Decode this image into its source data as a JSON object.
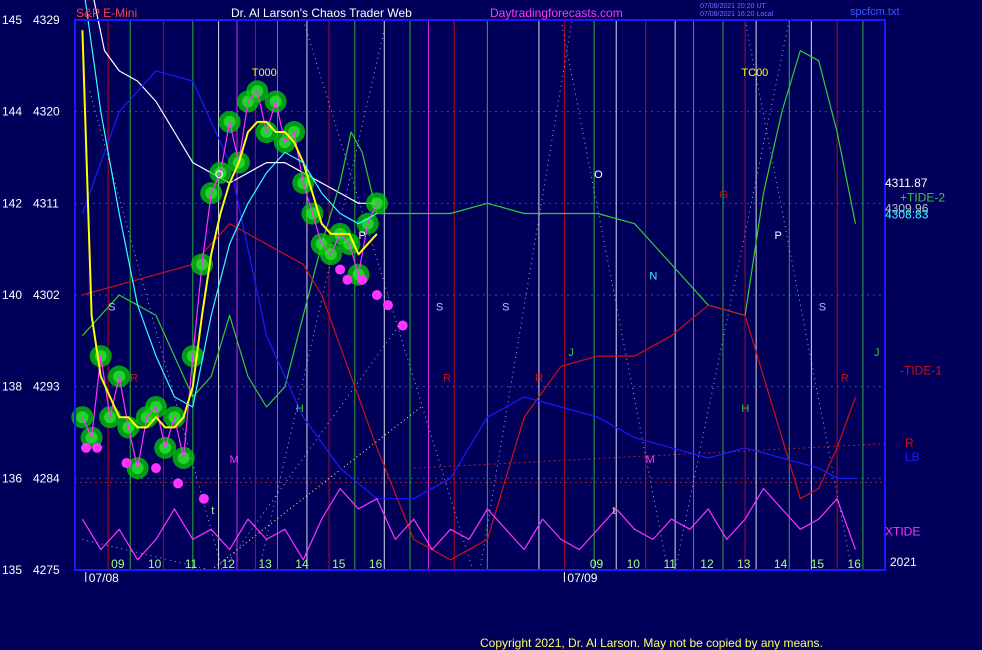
{
  "header": {
    "symbol": "S&P E-Mini",
    "title": "Dr. Al Larson's Chaos Trader Web",
    "site": "Daytradingforecasts.com",
    "file": "spcfcm.txt",
    "timestamp_line1": "07/08/2021 20:20 UT",
    "timestamp_line2": "07/08/2021 16:20 Local"
  },
  "footer": {
    "copyright": "Copyright 2021, Dr. Al Larson. May not be copied by any means."
  },
  "colors": {
    "background": "#00005a",
    "frame": "#1a1aff",
    "price": "#ff33ff",
    "ma_yellow": "#ffff00",
    "ma_cyan": "#33ffff",
    "ma_white": "#ffffff",
    "tide2_green": "#33cc33",
    "tide1_red": "#cc1111",
    "lb_blue": "#1a1aff",
    "xtide_magenta": "#ff33ff",
    "glow_green": "#00dd00",
    "tick_green": "#a0ff80"
  },
  "chart_data": {
    "type": "line",
    "title": "S&P E-Mini",
    "y_axis": {
      "ylim": [
        4275,
        4329
      ],
      "ticks": [
        {
          "index": "135",
          "price": "4275",
          "value": 4275
        },
        {
          "index": "136",
          "price": "4284",
          "value": 4284
        },
        {
          "index": "138",
          "price": "4293",
          "value": 4293
        },
        {
          "index": "140",
          "price": "4302",
          "value": 4302
        },
        {
          "index": "142",
          "price": "4311",
          "value": 4311
        },
        {
          "index": "144",
          "price": "4320",
          "value": 4320
        },
        {
          "index": "145",
          "price": "4329",
          "value": 4329
        }
      ]
    },
    "x_axis": {
      "ticks": [
        {
          "label": "09",
          "x": 9
        },
        {
          "label": "10",
          "x": 10
        },
        {
          "label": "11",
          "x": 11
        },
        {
          "label": "12",
          "x": 12
        },
        {
          "label": "13",
          "x": 13
        },
        {
          "label": "14",
          "x": 14
        },
        {
          "label": "15",
          "x": 15
        },
        {
          "label": "16",
          "x": 16
        },
        {
          "label": "09",
          "x": 22
        },
        {
          "label": "10",
          "x": 23
        },
        {
          "label": "11",
          "x": 24
        },
        {
          "label": "12",
          "x": 25
        },
        {
          "label": "13",
          "x": 26
        },
        {
          "label": "14",
          "x": 27
        },
        {
          "label": "15",
          "x": 28
        },
        {
          "label": "16",
          "x": 29
        }
      ],
      "dates": [
        {
          "label": "07/08",
          "x": 8.5
        },
        {
          "label": "07/09",
          "x": 21.5
        }
      ],
      "year": "2021"
    },
    "series": [
      {
        "name": "",
        "color": "#ff33ff",
        "x": [
          8.0,
          8.25,
          8.5,
          8.75,
          9.0,
          9.25,
          9.5,
          9.75,
          10.0,
          10.25,
          10.5,
          10.75,
          11.0,
          11.25,
          11.5,
          11.75,
          12.0,
          12.25,
          12.5,
          12.75,
          13.0,
          13.25,
          13.5,
          13.75,
          14.0,
          14.25,
          14.5,
          14.75,
          15.0,
          15.25,
          15.5,
          15.75,
          16.0
        ],
        "y": [
          4290,
          4288,
          4296,
          4290,
          4294,
          4289,
          4285,
          4290,
          4291,
          4287,
          4290,
          4286,
          4296,
          4305,
          4312,
          4314,
          4319,
          4315,
          4321,
          4322,
          4318,
          4321,
          4317,
          4318,
          4313,
          4310,
          4307,
          4306,
          4308,
          4307,
          4304,
          4309,
          4311
        ]
      },
      {
        "name": "",
        "color": "#ffff00",
        "x": [
          8.0,
          8.25,
          8.5,
          8.75,
          9.0,
          9.25,
          9.5,
          9.75,
          10.0,
          10.25,
          10.5,
          10.75,
          11.0,
          11.25,
          11.5,
          11.75,
          12.0,
          12.25,
          12.5,
          12.75,
          13.0,
          13.25,
          13.5,
          13.75,
          14.0,
          14.25,
          14.5,
          14.75,
          15.0,
          15.25,
          15.5,
          15.75,
          16.0
        ],
        "y": [
          4328,
          4300,
          4294,
          4292,
          4290,
          4290,
          4289,
          4289,
          4290,
          4289,
          4289,
          4290,
          4293,
          4300,
          4306,
          4310,
          4313,
          4315,
          4318,
          4319,
          4319,
          4318,
          4318,
          4317,
          4315,
          4312,
          4309,
          4308,
          4308,
          4308,
          4306,
          4307,
          4308
        ]
      },
      {
        "name": "",
        "color": "#33ffff",
        "x": [
          8.0,
          8.5,
          9.0,
          9.5,
          10.0,
          10.5,
          11.0,
          11.5,
          12.0,
          12.5,
          13.0,
          13.5,
          14.0,
          14.5,
          15.0,
          15.5,
          16.0
        ],
        "y": [
          4333,
          4320,
          4310,
          4301,
          4296,
          4292,
          4291,
          4300,
          4307,
          4311,
          4314,
          4316,
          4315,
          4312,
          4310,
          4309,
          4310
        ]
      },
      {
        "name": "",
        "color": "#ffffff",
        "x": [
          8.2,
          8.6,
          9.0,
          9.5,
          10.0,
          10.5,
          11.0,
          11.5,
          12.0,
          12.5,
          13.0,
          13.5,
          14.0,
          14.5,
          15.0,
          15.5,
          16.0
        ],
        "y": [
          4333,
          4326,
          4324,
          4323,
          4321,
          4318,
          4315,
          4314,
          4313,
          4314,
          4315,
          4315,
          4314,
          4313,
          4312,
          4311,
          4311
        ]
      },
      {
        "name": "TIDE-2",
        "color": "#33cc33",
        "x": [
          8.0,
          9.0,
          10.0,
          10.5,
          11.0,
          11.5,
          12.0,
          12.5,
          13.0,
          13.5,
          14.0,
          14.5,
          15.0,
          15.3,
          15.6,
          16.0,
          17.0,
          18.0,
          19.0,
          20.0,
          21.0,
          22.0,
          23.0,
          24.0,
          25.0,
          26.0,
          26.5,
          27.0,
          27.5,
          28.0,
          28.5,
          29.0
        ],
        "y": [
          4298,
          4302,
          4300,
          4296,
          4292,
          4294,
          4300,
          4294,
          4291,
          4293,
          4300,
          4307,
          4313,
          4318,
          4316,
          4310,
          4310,
          4310,
          4311,
          4310,
          4310,
          4310,
          4309,
          4305,
          4301,
          4300,
          4312,
          4320,
          4326,
          4325,
          4318,
          4309
        ]
      },
      {
        "name": "TIDE-1",
        "color": "#cc1111",
        "x": [
          8.0,
          9.0,
          10.0,
          11.0,
          12.0,
          13.0,
          14.0,
          14.5,
          15.0,
          15.5,
          16.0,
          17.0,
          18.0,
          19.0,
          20.0,
          21.0,
          22.0,
          23.0,
          24.0,
          25.0,
          26.0,
          27.0,
          27.5,
          28.0,
          28.5,
          29.0
        ],
        "y": [
          4302,
          4303,
          4304,
          4305,
          4309,
          4307,
          4305,
          4302,
          4297,
          4292,
          4287,
          4278,
          4276,
          4278,
          4290,
          4295,
          4296,
          4296,
          4298,
          4301,
          4300,
          4288,
          4282,
          4283,
          4287,
          4292
        ]
      },
      {
        "name": "LB",
        "color": "#1a1aff",
        "x": [
          8.0,
          9.0,
          10.0,
          11.0,
          12.0,
          13.0,
          14.0,
          15.0,
          16.0,
          17.0,
          18.0,
          19.0,
          20.0,
          21.0,
          22.0,
          23.0,
          24.0,
          25.0,
          26.0,
          27.0,
          28.0,
          28.5,
          29.0
        ],
        "y": [
          4310,
          4320,
          4324,
          4323,
          4315,
          4298,
          4290,
          4285,
          4282,
          4282,
          4284,
          4290,
          4292,
          4291,
          4290,
          4288,
          4287,
          4286,
          4287,
          4286,
          4285,
          4284,
          4284
        ]
      },
      {
        "name": "XTIDE",
        "color": "#ff33ff",
        "x": [
          8.0,
          8.5,
          9.0,
          9.5,
          10.0,
          10.5,
          11.0,
          11.5,
          12.0,
          12.5,
          13.0,
          13.5,
          14.0,
          14.5,
          15.0,
          15.5,
          16.0,
          16.5,
          17.0,
          17.5,
          18.0,
          18.5,
          19.0,
          19.5,
          20.0,
          20.5,
          21.0,
          21.5,
          22.0,
          22.5,
          23.0,
          23.5,
          24.0,
          24.5,
          25.0,
          25.5,
          26.0,
          26.5,
          27.0,
          27.5,
          28.0,
          28.5,
          29.0
        ],
        "y": [
          4280,
          4277,
          4279,
          4276,
          4278,
          4281,
          4278,
          4279,
          4277,
          4280,
          4278,
          4279,
          4276,
          4280,
          4283,
          4281,
          4282,
          4278,
          4280,
          4277,
          4279,
          4278,
          4281,
          4279,
          4277,
          4280,
          4278,
          4277,
          4279,
          4281,
          4279,
          4278,
          4280,
          4279,
          4281,
          4278,
          4280,
          4283,
          4281,
          4279,
          4280,
          4282,
          4277
        ]
      }
    ],
    "glow_x": [
      8.0,
      8.25,
      8.5,
      8.75,
      9.0,
      9.25,
      9.5,
      9.75,
      10.0,
      10.25,
      10.5,
      10.75,
      11.0,
      11.25,
      11.5,
      11.75,
      12.0,
      12.25,
      12.5,
      12.75,
      13.0,
      13.25,
      13.5,
      13.75,
      14.0,
      14.25,
      14.5,
      14.75,
      15.0,
      15.25,
      15.5,
      15.75,
      16.0
    ],
    "glow_y": [
      4290,
      4288,
      4296,
      4290,
      4294,
      4289,
      4285,
      4290,
      4291,
      4287,
      4290,
      4286,
      4296,
      4305,
      4312,
      4314,
      4319,
      4315,
      4321,
      4322,
      4318,
      4321,
      4317,
      4318,
      4313,
      4310,
      4307,
      4306,
      4308,
      4307,
      4304,
      4309,
      4311
    ],
    "lows": [
      {
        "x": 8.1,
        "y": 4287
      },
      {
        "x": 8.4,
        "y": 4287
      },
      {
        "x": 9.2,
        "y": 4285.5
      },
      {
        "x": 10.0,
        "y": 4285
      },
      {
        "x": 10.6,
        "y": 4283.5
      },
      {
        "x": 11.3,
        "y": 4282
      },
      {
        "x": 15.0,
        "y": 4304.5
      },
      {
        "x": 15.2,
        "y": 4303.5
      },
      {
        "x": 15.6,
        "y": 4303.5
      },
      {
        "x": 16.0,
        "y": 4302
      },
      {
        "x": 16.3,
        "y": 4301
      },
      {
        "x": 16.7,
        "y": 4299
      }
    ],
    "grid_levels": [
      4284,
      4293,
      4302,
      4311,
      4320
    ],
    "vlines": [
      {
        "x": 8.7,
        "color": "#cc1111"
      },
      {
        "x": 9.3,
        "color": "#33cc33"
      },
      {
        "x": 10.2,
        "color": "#cc1111"
      },
      {
        "x": 11.0,
        "color": "#33cc33"
      },
      {
        "x": 11.7,
        "color": "#ffffff"
      },
      {
        "x": 12.2,
        "color": "#ff33ff"
      },
      {
        "x": 12.7,
        "color": "#cc1111"
      },
      {
        "x": 13.3,
        "color": "#33cc33"
      },
      {
        "x": 14.1,
        "color": "#ffffff"
      },
      {
        "x": 14.7,
        "color": "#cc1111"
      },
      {
        "x": 15.4,
        "color": "#33cc33"
      },
      {
        "x": 16.2,
        "color": "#ffffff"
      },
      {
        "x": 16.9,
        "color": "#33cc33"
      },
      {
        "x": 17.4,
        "color": "#ff33ff"
      },
      {
        "x": 18.1,
        "color": "#cc1111"
      },
      {
        "x": 19.0,
        "color": "#33cc33"
      },
      {
        "x": 20.4,
        "color": "#ffffff"
      },
      {
        "x": 21.1,
        "color": "#cc1111"
      },
      {
        "x": 21.9,
        "color": "#33cc33"
      },
      {
        "x": 22.5,
        "color": "#ffffff"
      },
      {
        "x": 23.3,
        "color": "#cc1111"
      },
      {
        "x": 24.1,
        "color": "#ffffff"
      },
      {
        "x": 24.6,
        "color": "#ff33ff"
      },
      {
        "x": 25.4,
        "color": "#33cc33"
      },
      {
        "x": 26.0,
        "color": "#cc1111"
      },
      {
        "x": 26.3,
        "color": "#ffffff"
      },
      {
        "x": 27.2,
        "color": "#33cc33"
      },
      {
        "x": 27.8,
        "color": "#ffffff"
      },
      {
        "x": 28.5,
        "color": "#cc1111"
      },
      {
        "x": 29.2,
        "color": "#33cc33"
      }
    ],
    "markers": [
      {
        "text": "T000",
        "x": 12.6,
        "y": 4323.5,
        "color": "#ffff00"
      },
      {
        "text": "TC00",
        "x": 25.9,
        "y": 4323.5,
        "color": "#ffff00"
      },
      {
        "text": "O",
        "x": 11.6,
        "y": 4313.5,
        "color": "#ffffff"
      },
      {
        "text": "O",
        "x": 21.9,
        "y": 4313.5,
        "color": "#ffffff"
      },
      {
        "text": "P",
        "x": 15.5,
        "y": 4307.5,
        "color": "#ffffff"
      },
      {
        "text": "P",
        "x": 26.8,
        "y": 4307.5,
        "color": "#ffffff"
      },
      {
        "text": "S",
        "x": 8.7,
        "y": 4300.5,
        "color": "#c0c0ff"
      },
      {
        "text": "S",
        "x": 17.6,
        "y": 4300.5,
        "color": "#c0c0ff"
      },
      {
        "text": "S",
        "x": 19.4,
        "y": 4300.5,
        "color": "#c0c0ff"
      },
      {
        "text": "S",
        "x": 28.0,
        "y": 4300.5,
        "color": "#c0c0ff"
      },
      {
        "text": "N",
        "x": 23.4,
        "y": 4303.5,
        "color": "#33ffff"
      },
      {
        "text": "R",
        "x": 9.3,
        "y": 4293.5,
        "color": "#cc1111"
      },
      {
        "text": "R",
        "x": 17.8,
        "y": 4293.5,
        "color": "#cc1111"
      },
      {
        "text": "R",
        "x": 20.3,
        "y": 4293.5,
        "color": "#cc1111"
      },
      {
        "text": "R",
        "x": 28.6,
        "y": 4293.5,
        "color": "#cc1111"
      },
      {
        "text": "H",
        "x": 13.8,
        "y": 4290.5,
        "color": "#33cc33"
      },
      {
        "text": "H",
        "x": 25.9,
        "y": 4290.5,
        "color": "#33cc33"
      },
      {
        "text": "J",
        "x": 21.2,
        "y": 4296,
        "color": "#33cc33"
      },
      {
        "text": "J",
        "x": 29.5,
        "y": 4296,
        "color": "#33cc33"
      },
      {
        "text": "M",
        "x": 12.0,
        "y": 4285.5,
        "color": "#ff33ff"
      },
      {
        "text": "M",
        "x": 23.3,
        "y": 4285.5,
        "color": "#ff33ff"
      },
      {
        "text": "t",
        "x": 11.5,
        "y": 4280.5,
        "color": "#a0ff80"
      },
      {
        "text": "t",
        "x": 22.4,
        "y": 4280.5,
        "color": "#a0ff80"
      },
      {
        "text": "G",
        "x": 25.3,
        "y": 4311.5,
        "color": "#cc1111"
      }
    ],
    "right_labels": [
      {
        "text": "4311.87",
        "y": 4312.6,
        "color": "#ffffff"
      },
      {
        "text": "+TIDE-2",
        "y": 4311.2,
        "color": "#33cc33"
      },
      {
        "text": "4309.96",
        "y": 4310.1,
        "color": "#c0c0c0"
      },
      {
        "text": "4308.83",
        "y": 4309.5,
        "color": "#33ffff"
      },
      {
        "text": "-TIDE-1",
        "y": 4294.2,
        "color": "#cc1111"
      },
      {
        "text": "R",
        "y": 4287.1,
        "color": "#cc1111"
      },
      {
        "text": "LB",
        "y": 4285.7,
        "color": "#1a1aff"
      },
      {
        "text": "XTIDE",
        "y": 4278.4,
        "color": "#ff33ff"
      }
    ]
  }
}
